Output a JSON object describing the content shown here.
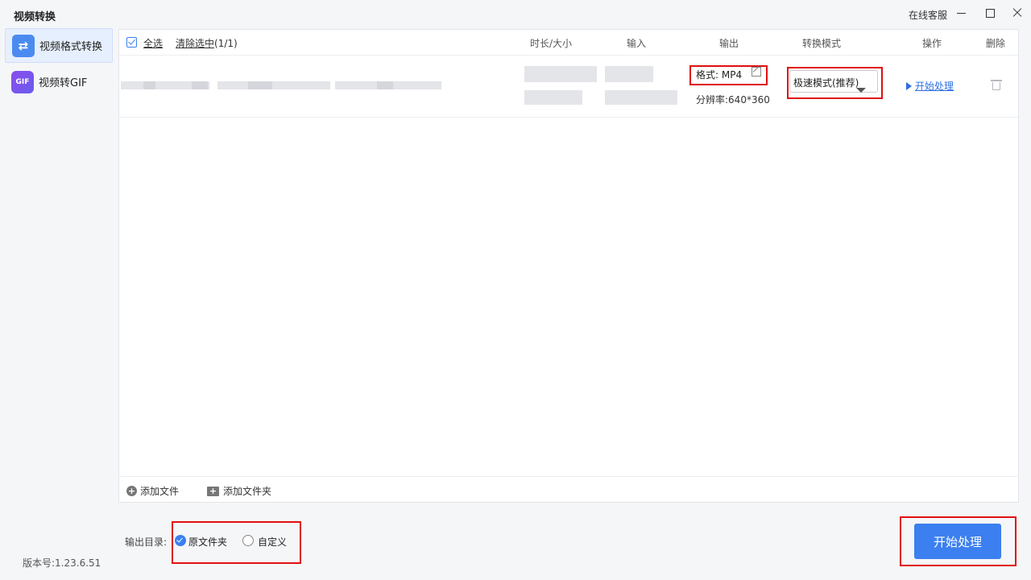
{
  "app": {
    "title": "视频转换"
  },
  "titlebar": {
    "service": "在线客服"
  },
  "sidebar": {
    "items": [
      {
        "label": "视频格式转换",
        "icon": "swap-arrows-icon",
        "icon_text": "⇄",
        "active": true
      },
      {
        "label": "视频转GIF",
        "icon": "gif-icon",
        "icon_text": "GIF",
        "active": false
      }
    ]
  },
  "version": "版本号:1.23.6.51",
  "table": {
    "select_all": "全选",
    "clear_selected": "清除选中",
    "selected_count": "(1/1)",
    "headers": {
      "duration_size": "时长/大小",
      "input": "输入",
      "output": "输出",
      "mode": "转换模式",
      "action": "操作",
      "delete": "删除"
    },
    "rows": [
      {
        "output_format": "格式: MP4",
        "output_resolution": "分辨率:640*360",
        "mode": "极速模式(推荐)",
        "action": "开始处理"
      }
    ]
  },
  "addbar": {
    "add_file": "添加文件",
    "add_folder": "添加文件夹"
  },
  "output_dir": {
    "label": "输出目录:",
    "options": [
      "原文件夹",
      "自定义"
    ],
    "selected": "原文件夹"
  },
  "start_button": "开始处理",
  "colors": {
    "accent": "#3b7ff0",
    "link": "#2f6fe0",
    "highlight_box": "#e01010"
  }
}
